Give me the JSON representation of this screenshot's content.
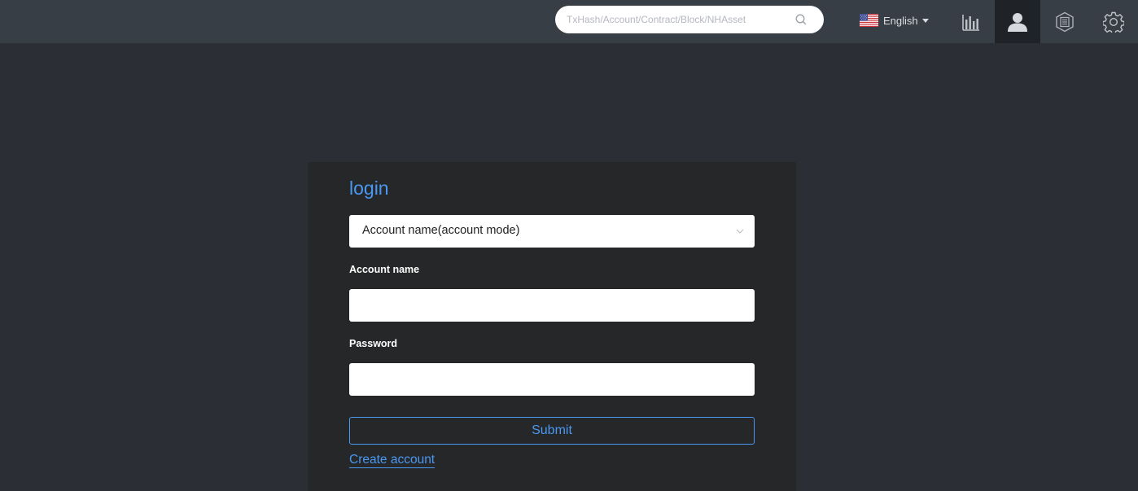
{
  "header": {
    "search": {
      "placeholder": "TxHash/Account/Contract/Block/NHAsset",
      "value": ""
    },
    "language": {
      "label": "English",
      "flag_icon": "us-flag-icon"
    },
    "nav_icons": [
      "bar-chart-icon",
      "user-icon",
      "contract-icon",
      "gear-icon"
    ],
    "active_nav": "user-icon"
  },
  "login": {
    "title": "login",
    "mode_select": {
      "selected": "Account name(account mode)"
    },
    "account_name": {
      "label": "Account name",
      "value": ""
    },
    "password": {
      "label": "Password",
      "value": ""
    },
    "submit_label": "Submit",
    "create_account_label": "Create account"
  },
  "colors": {
    "background": "#2b2f35",
    "topbar": "#383e46",
    "card": "#262728",
    "accent": "#4a98f2",
    "active_nav": "#1f2226"
  }
}
